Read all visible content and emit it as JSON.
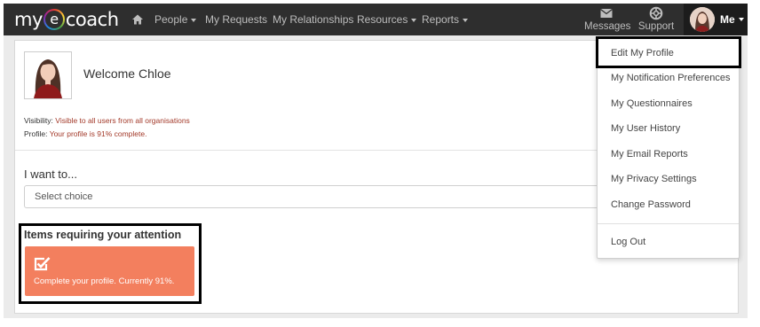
{
  "brand": {
    "my": "my",
    "e": "e",
    "coach": "coach"
  },
  "nav": {
    "items": [
      {
        "label": "People",
        "dropdown": true
      },
      {
        "label": "My Requests",
        "dropdown": false
      },
      {
        "label": "My Relationships",
        "dropdown": false
      },
      {
        "label": "Resources",
        "dropdown": true
      },
      {
        "label": "Reports",
        "dropdown": true
      }
    ],
    "messages_label": "Messages",
    "support_label": "Support",
    "me_label": "Me"
  },
  "profile": {
    "welcome": "Welcome Chloe",
    "visibility_label": "Visibility:",
    "visibility_value": "Visible to all users from all organisations",
    "profile_label": "Profile:",
    "profile_value": "Your profile is 91% complete."
  },
  "want": {
    "label": "I want to...",
    "placeholder": "Select choice"
  },
  "attention": {
    "title": "Items requiring your attention",
    "card_text": "Complete your profile. Currently 91%."
  },
  "menu": {
    "items": [
      "Edit My Profile",
      "My Notification Preferences",
      "My Questionnaires",
      "My User History",
      "My Email Reports",
      "My Privacy Settings",
      "Change Password"
    ],
    "logout": "Log Out"
  },
  "colors": {
    "navbar": "#2e2e2e",
    "accent_card": "#f37f5e",
    "info_value": "#a33a2a"
  }
}
